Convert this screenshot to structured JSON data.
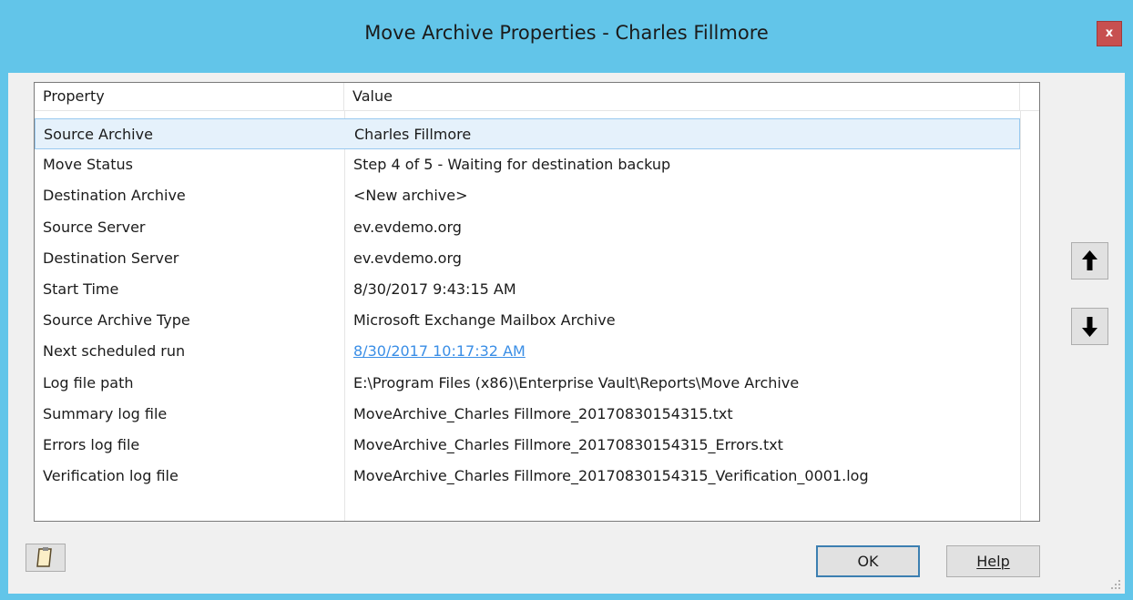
{
  "window": {
    "title": "Move Archive Properties - Charles Fillmore",
    "close_label": "x"
  },
  "grid": {
    "columns": [
      "Property",
      "Value"
    ],
    "rows": [
      {
        "property": "Source Archive",
        "value": "Charles Fillmore"
      },
      {
        "property": "Move Status",
        "value": "Step 4 of 5 - Waiting for destination backup"
      },
      {
        "property": "Destination Archive",
        "value": "<New archive>"
      },
      {
        "property": "Source Server",
        "value": "ev.evdemo.org"
      },
      {
        "property": "Destination Server",
        "value": "ev.evdemo.org"
      },
      {
        "property": "Start Time",
        "value": "8/30/2017 9:43:15 AM"
      },
      {
        "property": "Source Archive Type",
        "value": "Microsoft Exchange Mailbox Archive"
      },
      {
        "property": "Next scheduled run",
        "value": "8/30/2017 10:17:32 AM"
      },
      {
        "property": "Log file path",
        "value": "E:\\Program Files (x86)\\Enterprise Vault\\Reports\\Move Archive"
      },
      {
        "property": "Summary log file",
        "value": "MoveArchive_Charles Fillmore_20170830154315.txt"
      },
      {
        "property": "Errors log file",
        "value": "MoveArchive_Charles Fillmore_20170830154315_Errors.txt"
      },
      {
        "property": "Verification log file",
        "value": "MoveArchive_Charles Fillmore_20170830154315_Verification_0001.log"
      }
    ]
  },
  "buttons": {
    "ok": "OK",
    "help": "Help"
  },
  "icons": {
    "move_up": "arrow-up-icon",
    "move_down": "arrow-down-icon",
    "copy": "clipboard-icon"
  },
  "colors": {
    "titlebar": "#62c5e9",
    "close": "#c75050",
    "selection": "#e5f1fb",
    "link": "#3a8ee6"
  }
}
